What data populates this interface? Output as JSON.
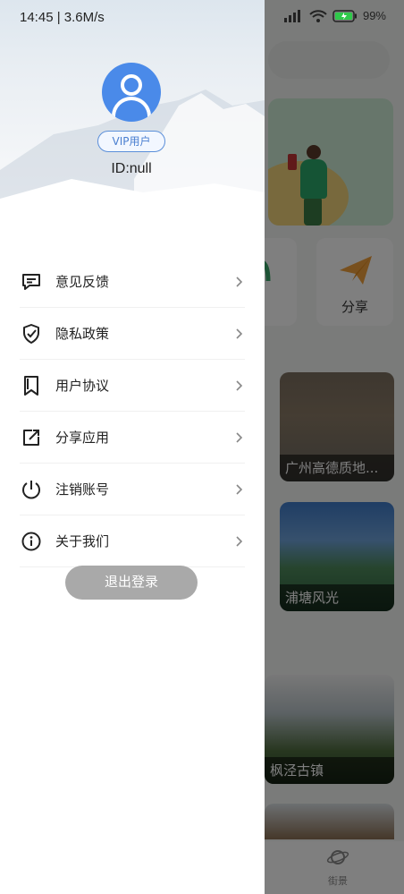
{
  "status_bar": {
    "time": "14:45 | 3.6M/s",
    "battery": "99%"
  },
  "drawer": {
    "vip_label": "VIP用户",
    "user_id": "ID:null",
    "menu": [
      {
        "label": "意见反馈",
        "icon": "feedback-icon"
      },
      {
        "label": "隐私政策",
        "icon": "shield-check-icon"
      },
      {
        "label": "用户协议",
        "icon": "bookmark-icon"
      },
      {
        "label": "分享应用",
        "icon": "external-link-icon"
      },
      {
        "label": "注销账号",
        "icon": "power-icon"
      },
      {
        "label": "关于我们",
        "icon": "info-icon"
      }
    ],
    "logout_label": "退出登录"
  },
  "background": {
    "feature_share_label": "分享",
    "photos": [
      {
        "caption": "广州高德质地..."
      },
      {
        "caption": "浦塘风光"
      },
      {
        "caption": "枫泾古镇"
      }
    ],
    "nav_label": "街景"
  }
}
